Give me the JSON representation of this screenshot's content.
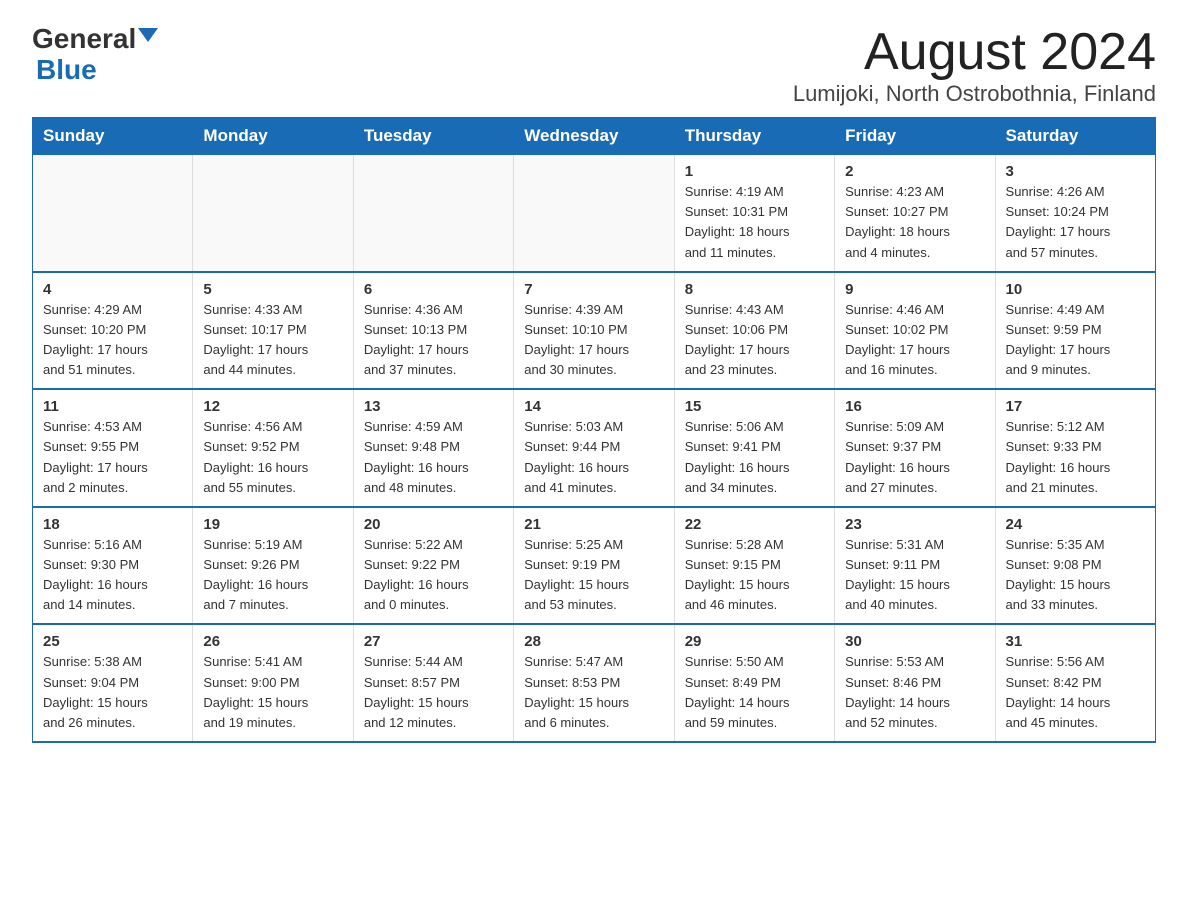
{
  "header": {
    "logo_general": "General",
    "logo_blue": "Blue",
    "title": "August 2024",
    "subtitle": "Lumijoki, North Ostrobothnia, Finland"
  },
  "weekdays": [
    "Sunday",
    "Monday",
    "Tuesday",
    "Wednesday",
    "Thursday",
    "Friday",
    "Saturday"
  ],
  "weeks": [
    [
      {
        "day": "",
        "info": ""
      },
      {
        "day": "",
        "info": ""
      },
      {
        "day": "",
        "info": ""
      },
      {
        "day": "",
        "info": ""
      },
      {
        "day": "1",
        "info": "Sunrise: 4:19 AM\nSunset: 10:31 PM\nDaylight: 18 hours\nand 11 minutes."
      },
      {
        "day": "2",
        "info": "Sunrise: 4:23 AM\nSunset: 10:27 PM\nDaylight: 18 hours\nand 4 minutes."
      },
      {
        "day": "3",
        "info": "Sunrise: 4:26 AM\nSunset: 10:24 PM\nDaylight: 17 hours\nand 57 minutes."
      }
    ],
    [
      {
        "day": "4",
        "info": "Sunrise: 4:29 AM\nSunset: 10:20 PM\nDaylight: 17 hours\nand 51 minutes."
      },
      {
        "day": "5",
        "info": "Sunrise: 4:33 AM\nSunset: 10:17 PM\nDaylight: 17 hours\nand 44 minutes."
      },
      {
        "day": "6",
        "info": "Sunrise: 4:36 AM\nSunset: 10:13 PM\nDaylight: 17 hours\nand 37 minutes."
      },
      {
        "day": "7",
        "info": "Sunrise: 4:39 AM\nSunset: 10:10 PM\nDaylight: 17 hours\nand 30 minutes."
      },
      {
        "day": "8",
        "info": "Sunrise: 4:43 AM\nSunset: 10:06 PM\nDaylight: 17 hours\nand 23 minutes."
      },
      {
        "day": "9",
        "info": "Sunrise: 4:46 AM\nSunset: 10:02 PM\nDaylight: 17 hours\nand 16 minutes."
      },
      {
        "day": "10",
        "info": "Sunrise: 4:49 AM\nSunset: 9:59 PM\nDaylight: 17 hours\nand 9 minutes."
      }
    ],
    [
      {
        "day": "11",
        "info": "Sunrise: 4:53 AM\nSunset: 9:55 PM\nDaylight: 17 hours\nand 2 minutes."
      },
      {
        "day": "12",
        "info": "Sunrise: 4:56 AM\nSunset: 9:52 PM\nDaylight: 16 hours\nand 55 minutes."
      },
      {
        "day": "13",
        "info": "Sunrise: 4:59 AM\nSunset: 9:48 PM\nDaylight: 16 hours\nand 48 minutes."
      },
      {
        "day": "14",
        "info": "Sunrise: 5:03 AM\nSunset: 9:44 PM\nDaylight: 16 hours\nand 41 minutes."
      },
      {
        "day": "15",
        "info": "Sunrise: 5:06 AM\nSunset: 9:41 PM\nDaylight: 16 hours\nand 34 minutes."
      },
      {
        "day": "16",
        "info": "Sunrise: 5:09 AM\nSunset: 9:37 PM\nDaylight: 16 hours\nand 27 minutes."
      },
      {
        "day": "17",
        "info": "Sunrise: 5:12 AM\nSunset: 9:33 PM\nDaylight: 16 hours\nand 21 minutes."
      }
    ],
    [
      {
        "day": "18",
        "info": "Sunrise: 5:16 AM\nSunset: 9:30 PM\nDaylight: 16 hours\nand 14 minutes."
      },
      {
        "day": "19",
        "info": "Sunrise: 5:19 AM\nSunset: 9:26 PM\nDaylight: 16 hours\nand 7 minutes."
      },
      {
        "day": "20",
        "info": "Sunrise: 5:22 AM\nSunset: 9:22 PM\nDaylight: 16 hours\nand 0 minutes."
      },
      {
        "day": "21",
        "info": "Sunrise: 5:25 AM\nSunset: 9:19 PM\nDaylight: 15 hours\nand 53 minutes."
      },
      {
        "day": "22",
        "info": "Sunrise: 5:28 AM\nSunset: 9:15 PM\nDaylight: 15 hours\nand 46 minutes."
      },
      {
        "day": "23",
        "info": "Sunrise: 5:31 AM\nSunset: 9:11 PM\nDaylight: 15 hours\nand 40 minutes."
      },
      {
        "day": "24",
        "info": "Sunrise: 5:35 AM\nSunset: 9:08 PM\nDaylight: 15 hours\nand 33 minutes."
      }
    ],
    [
      {
        "day": "25",
        "info": "Sunrise: 5:38 AM\nSunset: 9:04 PM\nDaylight: 15 hours\nand 26 minutes."
      },
      {
        "day": "26",
        "info": "Sunrise: 5:41 AM\nSunset: 9:00 PM\nDaylight: 15 hours\nand 19 minutes."
      },
      {
        "day": "27",
        "info": "Sunrise: 5:44 AM\nSunset: 8:57 PM\nDaylight: 15 hours\nand 12 minutes."
      },
      {
        "day": "28",
        "info": "Sunrise: 5:47 AM\nSunset: 8:53 PM\nDaylight: 15 hours\nand 6 minutes."
      },
      {
        "day": "29",
        "info": "Sunrise: 5:50 AM\nSunset: 8:49 PM\nDaylight: 14 hours\nand 59 minutes."
      },
      {
        "day": "30",
        "info": "Sunrise: 5:53 AM\nSunset: 8:46 PM\nDaylight: 14 hours\nand 52 minutes."
      },
      {
        "day": "31",
        "info": "Sunrise: 5:56 AM\nSunset: 8:42 PM\nDaylight: 14 hours\nand 45 minutes."
      }
    ]
  ]
}
